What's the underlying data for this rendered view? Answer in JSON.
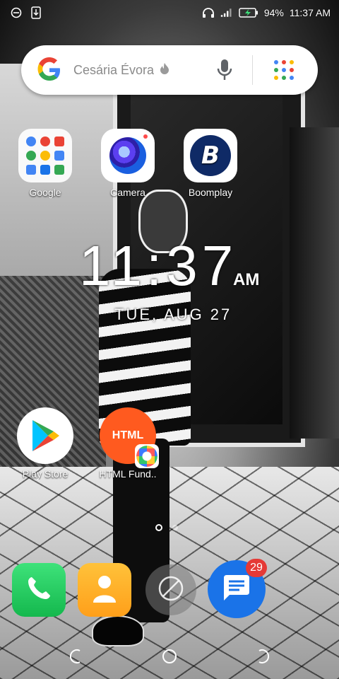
{
  "status_bar": {
    "battery_percent": "94%",
    "time": "11:37 AM",
    "icons": [
      "notification-circle-icon",
      "download-icon",
      "headphones-icon",
      "signal-icon",
      "battery-charging-icon"
    ]
  },
  "search": {
    "placeholder": "Cesária Évora",
    "icons": [
      "google-logo-icon",
      "fire-icon",
      "microphone-icon",
      "apps-grid-icon"
    ]
  },
  "apps": [
    {
      "label": "Google",
      "icon": "google-folder-icon"
    },
    {
      "label": "Camera",
      "icon": "camera-icon"
    },
    {
      "label": "Boomplay",
      "icon": "boomplay-icon"
    },
    {
      "label": "Play Store",
      "icon": "play-store-icon"
    },
    {
      "label": "HTML Fund..",
      "icon": "html-fundamentals-icon",
      "icon_text": "HTML"
    }
  ],
  "clock": {
    "time": "11:37",
    "ampm": "AM",
    "date": "TUE, AUG 27"
  },
  "page_indicator": {
    "pages": 3,
    "current": 1
  },
  "dock": {
    "items": [
      {
        "name": "phone",
        "icon": "phone-icon"
      },
      {
        "name": "contacts",
        "icon": "contacts-icon"
      },
      {
        "name": "browser",
        "icon": "browser-icon"
      },
      {
        "name": "messages",
        "icon": "messages-icon",
        "badge": "29"
      }
    ]
  },
  "nav_bar": {
    "buttons": [
      "back-icon",
      "home-icon",
      "recents-icon"
    ]
  },
  "colors": {
    "google_blue": "#4285F4",
    "google_red": "#EA4335",
    "google_yellow": "#FBBC05",
    "google_green": "#34A853",
    "html_orange": "#ff5a1f",
    "messages_blue": "#1a73e8",
    "badge_red": "#e53935"
  }
}
